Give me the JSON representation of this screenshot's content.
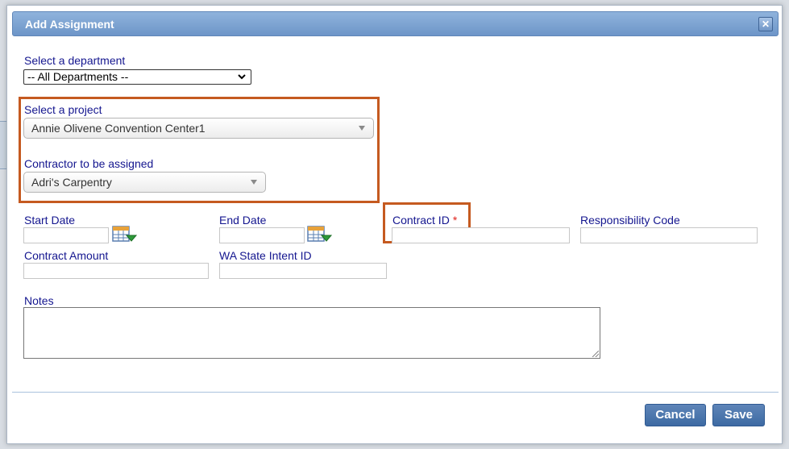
{
  "dialog": {
    "title": "Add Assignment",
    "close_glyph": "✕"
  },
  "department": {
    "label": "Select a department",
    "value": "-- All Departments --"
  },
  "project": {
    "label": "Select a project",
    "value": "Annie Olivene Convention Center1"
  },
  "contractor": {
    "label": "Contractor to be assigned",
    "value": "Adri's Carpentry"
  },
  "fields": {
    "start_date": {
      "label": "Start Date",
      "value": ""
    },
    "end_date": {
      "label": "End Date",
      "value": ""
    },
    "contract_id": {
      "label": "Contract ID",
      "required_mark": "*",
      "value": ""
    },
    "responsibility_code": {
      "label": "Responsibility Code",
      "value": ""
    },
    "contract_amount": {
      "label": "Contract Amount",
      "value": ""
    },
    "wa_state_intent_id": {
      "label": "WA State Intent ID",
      "value": ""
    },
    "notes": {
      "label": "Notes",
      "value": ""
    }
  },
  "buttons": {
    "cancel": "Cancel",
    "save": "Save"
  },
  "colors": {
    "label_text": "#14168f",
    "highlight_box": "#c55a20",
    "title_bar": "#7aa0d0",
    "button": "#4a74ab",
    "required": "#e0201a"
  },
  "icons": [
    "calendar-icon",
    "close-icon",
    "chevron-down-icon"
  ]
}
